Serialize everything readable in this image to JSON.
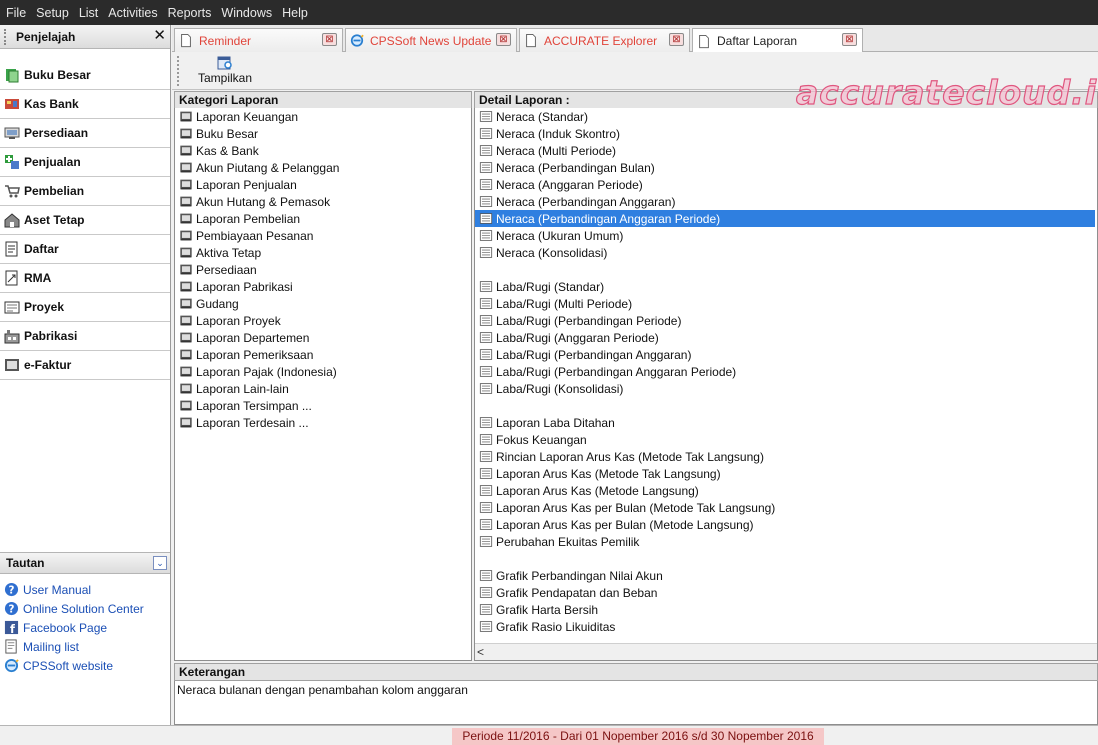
{
  "menu": [
    "File",
    "Setup",
    "List",
    "Activities",
    "Reports",
    "Windows",
    "Help"
  ],
  "left_panel": {
    "title": "Penjelajah",
    "close_glyph": "✕",
    "nav_items": [
      {
        "label": "Buku Besar",
        "icon": "ledger-icon"
      },
      {
        "label": "Kas Bank",
        "icon": "bank-icon"
      },
      {
        "label": "Persediaan",
        "icon": "inventory-icon"
      },
      {
        "label": "Penjualan",
        "icon": "sales-icon"
      },
      {
        "label": "Pembelian",
        "icon": "cart-icon"
      },
      {
        "label": "Aset Tetap",
        "icon": "building-icon"
      },
      {
        "label": "Daftar",
        "icon": "list-icon"
      },
      {
        "label": "RMA",
        "icon": "rma-icon"
      },
      {
        "label": "Proyek",
        "icon": "project-icon"
      },
      {
        "label": "Pabrikasi",
        "icon": "factory-icon"
      },
      {
        "label": "e-Faktur",
        "icon": "invoice-icon"
      }
    ],
    "tautan_title": "Tautan",
    "links": [
      {
        "label": "User Manual",
        "icon": "help-icon"
      },
      {
        "label": "Online Solution Center",
        "icon": "help-icon"
      },
      {
        "label": "Facebook Page",
        "icon": "facebook-icon"
      },
      {
        "label": "Mailing list",
        "icon": "mail-icon"
      },
      {
        "label": "CPSSoft website",
        "icon": "browser-icon"
      }
    ]
  },
  "tabs": [
    {
      "label": "Reminder",
      "icon": "document-icon",
      "active": false
    },
    {
      "label": "CPSSoft News Update",
      "icon": "browser-icon",
      "active": false
    },
    {
      "label": "ACCURATE Explorer",
      "icon": "document-icon",
      "active": false
    },
    {
      "label": "Daftar Laporan",
      "icon": "document-icon",
      "active": true
    }
  ],
  "toolbar": {
    "tampilkan_label": "Tampilkan"
  },
  "kategori": {
    "header": "Kategori Laporan",
    "items": [
      "Laporan Keuangan",
      "Buku Besar",
      "Kas & Bank",
      "Akun Piutang & Pelanggan",
      "Laporan Penjualan",
      "Akun Hutang & Pemasok",
      "Laporan Pembelian",
      "Pembiayaan Pesanan",
      "Aktiva Tetap",
      "Persediaan",
      "Laporan Pabrikasi",
      "Gudang",
      "Laporan Proyek",
      "Laporan Departemen",
      "Laporan Pemeriksaan",
      "Laporan Pajak (Indonesia)",
      "Laporan Lain-lain",
      "Laporan Tersimpan ...",
      "Laporan Terdesain ..."
    ]
  },
  "detail": {
    "header": "Detail Laporan :",
    "selected": "Neraca (Perbandingan Anggaran Periode)",
    "items": [
      "Neraca (Standar)",
      "Neraca (Induk Skontro)",
      "Neraca (Multi Periode)",
      "Neraca (Perbandingan Bulan)",
      "Neraca (Anggaran Periode)",
      "Neraca (Perbandingan Anggaran)",
      "Neraca (Perbandingan Anggaran Periode)",
      "Neraca (Ukuran Umum)",
      "Neraca (Konsolidasi)",
      "",
      "Laba/Rugi (Standar)",
      "Laba/Rugi (Multi Periode)",
      "Laba/Rugi (Perbandingan Periode)",
      "Laba/Rugi (Anggaran Periode)",
      "Laba/Rugi (Perbandingan Anggaran)",
      "Laba/Rugi (Perbandingan Anggaran Periode)",
      "Laba/Rugi (Konsolidasi)",
      "",
      "Laporan Laba Ditahan",
      "Fokus Keuangan",
      "Rincian Laporan Arus Kas (Metode Tak Langsung)",
      "Laporan Arus Kas (Metode Tak Langsung)",
      "Laporan Arus Kas (Metode Langsung)",
      "Laporan Arus Kas per Bulan (Metode Tak Langsung)",
      "Laporan Arus Kas per Bulan (Metode Langsung)",
      "Perubahan Ekuitas Pemilik",
      "",
      "Grafik Perbandingan Nilai Akun",
      "Grafik Pendapatan dan Beban",
      "Grafik Harta Bersih",
      "Grafik Rasio Likuiditas"
    ]
  },
  "keterangan": {
    "header": "Keterangan",
    "text": "Neraca bulanan dengan penambahan kolom anggaran"
  },
  "status": {
    "periode": "Periode 11/2016 - Dari 01 Nopember 2016 s/d 30 Nopember 2016"
  },
  "watermark": "accuratecloud.id",
  "colors": {
    "selection": "#2f7fe0",
    "tab_text": "#e0443a",
    "link": "#1b4fb5",
    "status_bg": "#f5c7c7"
  }
}
